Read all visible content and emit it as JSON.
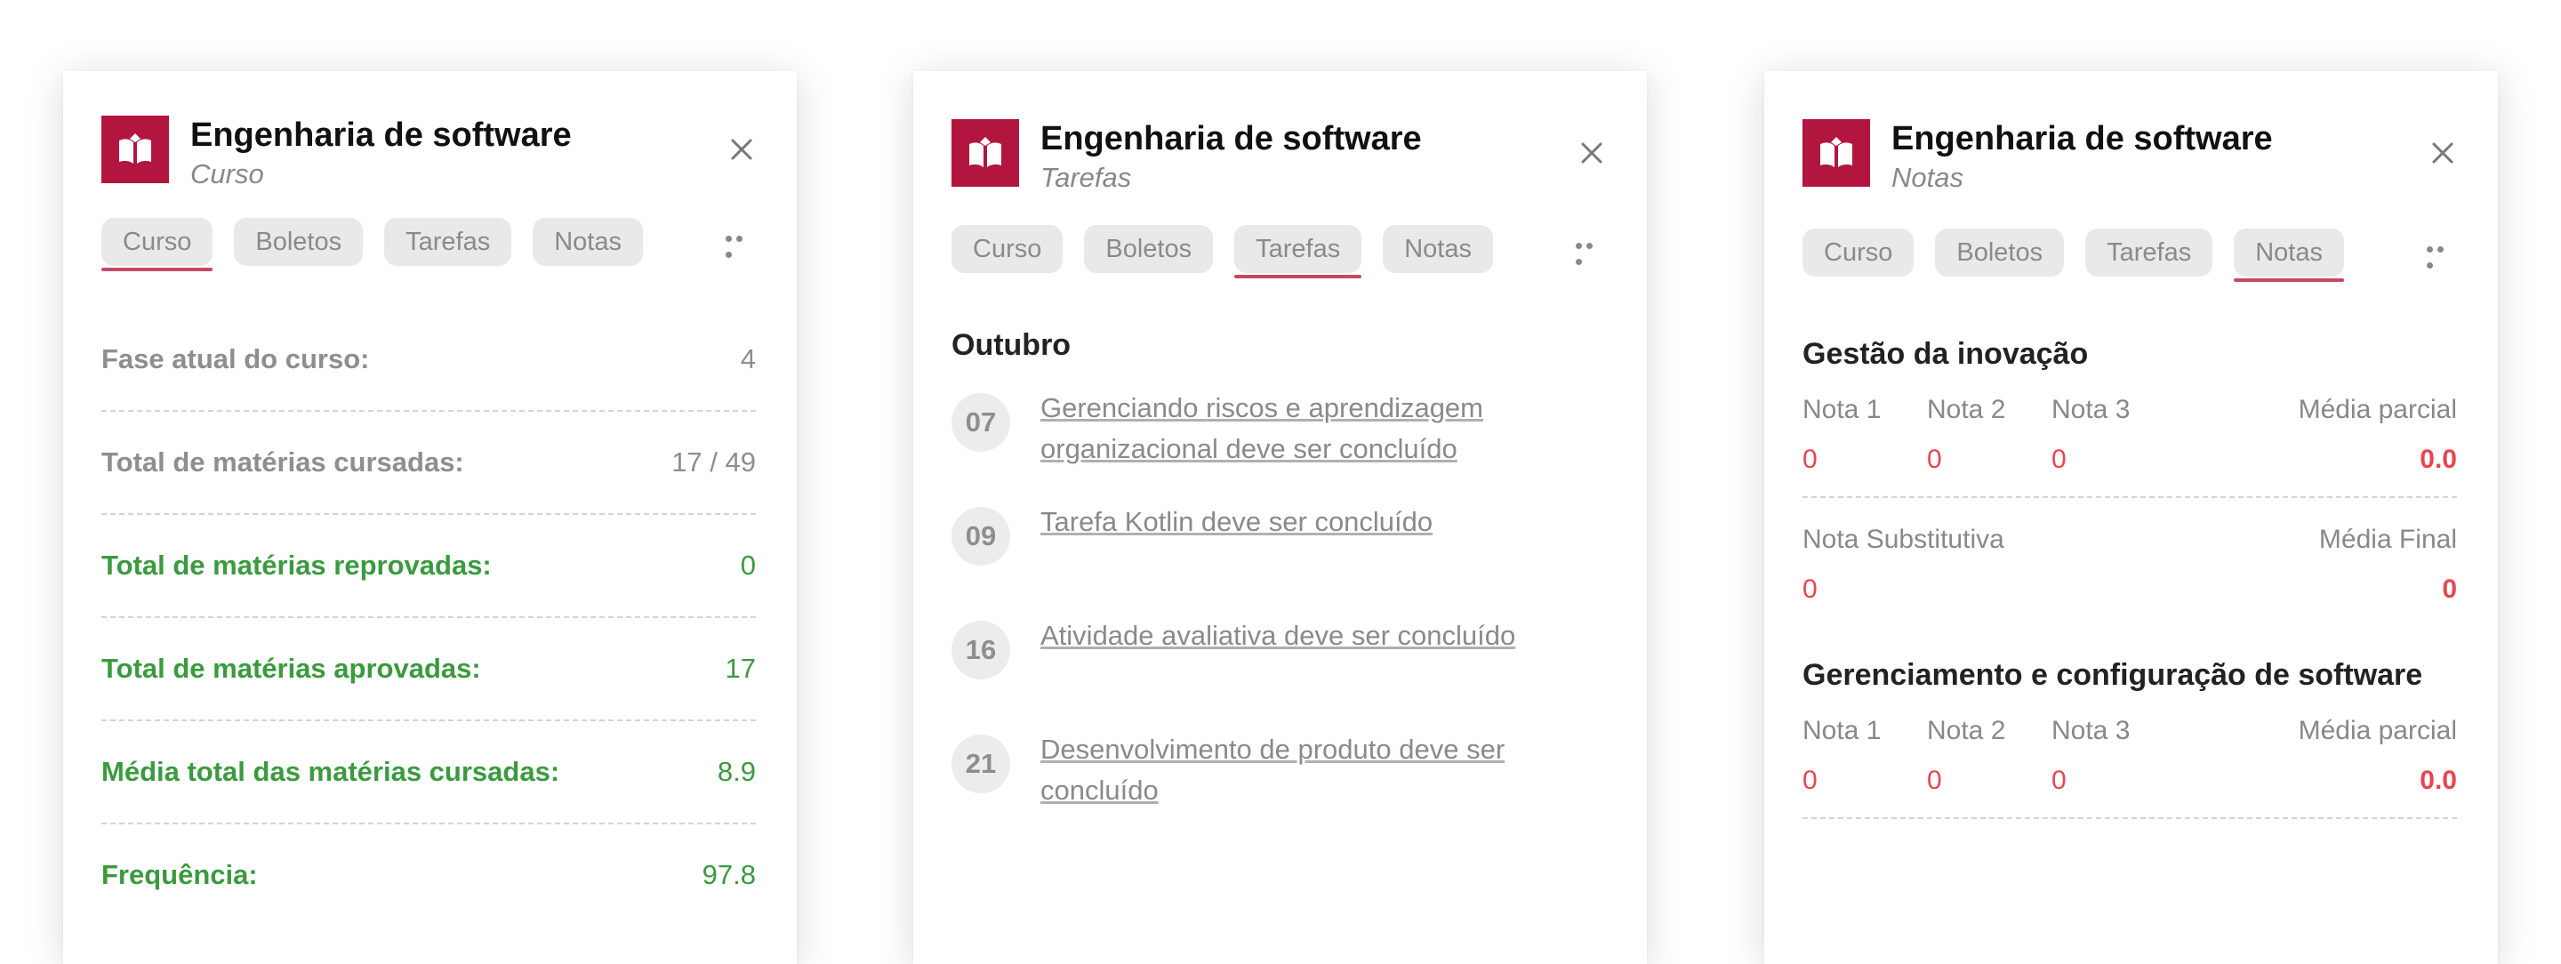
{
  "colors": {
    "brand": "#b2163f",
    "accent_underline": "#c24a63",
    "green": "#3b9a3f",
    "red": "#e9454f"
  },
  "icons": {
    "logo": "open-book-logo-icon",
    "close": "close-icon",
    "more": "more-horizontal-icon"
  },
  "tabs": [
    "Curso",
    "Boletos",
    "Tarefas",
    "Notas"
  ],
  "cards": [
    {
      "title": "Engenharia de software",
      "subtitle": "Curso",
      "active_tab": "Curso",
      "rows": [
        {
          "label": "Fase atual do curso:",
          "value": "4",
          "tone": "gray"
        },
        {
          "label": "Total de matérias cursadas:",
          "value": "17 / 49",
          "tone": "gray"
        },
        {
          "label": "Total de matérias reprovadas:",
          "value": "0",
          "tone": "green"
        },
        {
          "label": "Total de matérias aprovadas:",
          "value": "17",
          "tone": "green"
        },
        {
          "label": "Média total das matérias cursadas:",
          "value": "8.9",
          "tone": "green"
        },
        {
          "label": "Frequência:",
          "value": "97.8",
          "tone": "green"
        }
      ]
    },
    {
      "title": "Engenharia de software",
      "subtitle": "Tarefas",
      "active_tab": "Tarefas",
      "month": "Outubro",
      "tasks": [
        {
          "day": "07",
          "text": "Gerenciando riscos e aprendizagem organizacional deve ser concluído"
        },
        {
          "day": "09",
          "text": "Tarefa Kotlin deve ser concluído"
        },
        {
          "day": "16",
          "text": "Atividade avaliativa deve ser concluído"
        },
        {
          "day": "21",
          "text": "Desenvolvimento de produto deve ser concluído"
        }
      ]
    },
    {
      "title": "Engenharia de software",
      "subtitle": "Notas",
      "active_tab": "Notas",
      "grade_labels": {
        "n1": "Nota 1",
        "n2": "Nota 2",
        "n3": "Nota 3",
        "partial": "Média parcial",
        "substitute": "Nota Substitutiva",
        "final": "Média Final"
      },
      "subjects": [
        {
          "name": "Gestão da inovação",
          "n1": "0",
          "n2": "0",
          "n3": "0",
          "partial": "0.0",
          "substitute": "0",
          "final": "0"
        },
        {
          "name": "Gerenciamento e configuração de software",
          "n1": "0",
          "n2": "0",
          "n3": "0",
          "partial": "0.0"
        }
      ]
    }
  ]
}
